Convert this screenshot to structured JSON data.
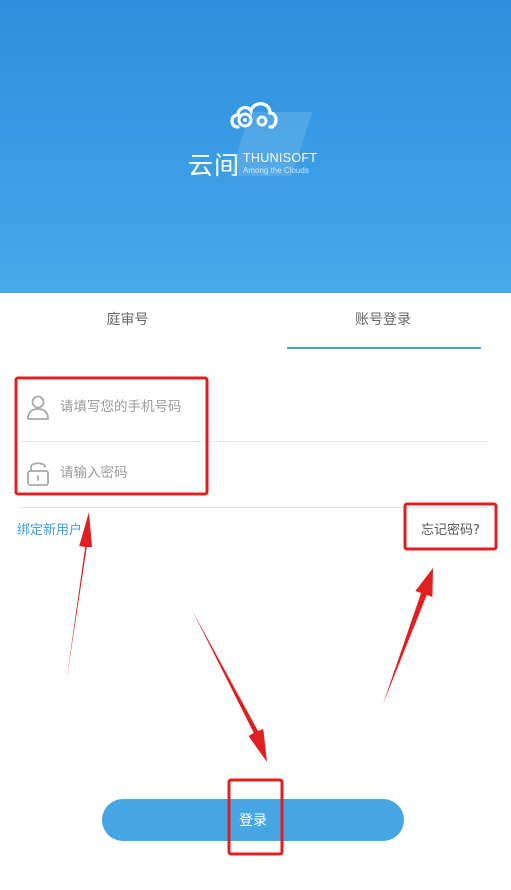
{
  "brand": {
    "name_cn": "云间",
    "name_en": "THUNISOFT",
    "tagline": "Among the Clouds",
    "logo_icon": "cloud-logo-icon"
  },
  "tabs": [
    {
      "label": "庭审号",
      "active": false
    },
    {
      "label": "账号登录",
      "active": true
    }
  ],
  "form": {
    "phone": {
      "placeholder": "请填写您的手机号码",
      "value": "",
      "icon": "user-icon"
    },
    "password": {
      "placeholder": "请输入密码",
      "value": "",
      "icon": "lock-icon"
    }
  },
  "links": {
    "bind_new_user": "绑定新用户",
    "forgot_password": "忘记密码?"
  },
  "login_button": "登录",
  "colors": {
    "header_gradient_top": "#2f8edd",
    "header_gradient_bottom": "#48a9ea",
    "accent": "#41a4e0",
    "login_button": "#45a6e3",
    "annotation_red": "#e02020"
  }
}
